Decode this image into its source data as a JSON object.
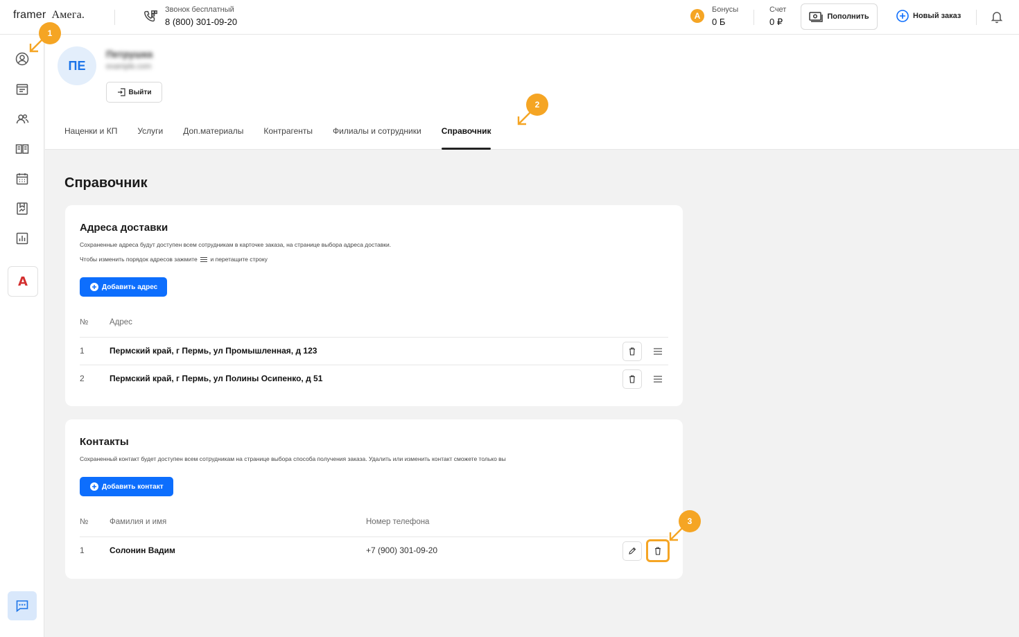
{
  "topbar": {
    "logo_primary": "framer",
    "logo_secondary": "Амега.",
    "call_label": "Звонок бесплатный",
    "call_number": "8 (800) 301-09-20",
    "bonus_icon_letter": "A",
    "bonus_label": "Бонусы",
    "bonus_value": "0 Б",
    "account_label": "Счет",
    "account_value": "0 ₽",
    "topup_label": "Пополнить",
    "new_order_label": "Новый заказ"
  },
  "sidebar": {
    "items": [
      "profile-icon",
      "orders-icon",
      "users-icon",
      "catalog-icon",
      "calendar-icon",
      "gallery-icon",
      "reports-icon"
    ],
    "brand_letter": "A"
  },
  "profile": {
    "initials": "ПЕ",
    "name": "Петрушка",
    "email": "example.com",
    "logout_label": "Выйти"
  },
  "tabs": [
    {
      "label": "Наценки и КП",
      "active": false
    },
    {
      "label": "Услуги",
      "active": false
    },
    {
      "label": "Доп.материалы",
      "active": false
    },
    {
      "label": "Контрагенты",
      "active": false
    },
    {
      "label": "Филиалы и сотрудники",
      "active": false
    },
    {
      "label": "Справочник",
      "active": true
    }
  ],
  "page_title": "Справочник",
  "addresses": {
    "title": "Адреса доставки",
    "desc1": "Сохраненные адреса будут доступен всем сотрудникам в карточке заказа, на странице выбора адреса доставки.",
    "desc2_before": "Чтобы изменить порядок адресов зажмите",
    "desc2_after": "и перетащите строку",
    "add_label": "Добавить адрес",
    "col_num": "№",
    "col_address": "Адрес",
    "rows": [
      {
        "num": "1",
        "address": "Пермский край, г Пермь, ул Промышленная, д 123"
      },
      {
        "num": "2",
        "address": "Пермский край, г Пермь, ул Полины Осипенко, д 51"
      }
    ]
  },
  "contacts": {
    "title": "Контакты",
    "desc": "Сохраненный контакт будет доступен всем сотрудникам на странице выбора способа получения заказа. Удалить или изменить контакт сможете только вы",
    "add_label": "Добавить контакт",
    "col_num": "№",
    "col_name": "Фамилия и имя",
    "col_phone": "Номер телефона",
    "rows": [
      {
        "num": "1",
        "name": "Солонин Вадим",
        "phone": "+7 (900) 301-09-20"
      }
    ]
  },
  "markers": [
    "1",
    "2",
    "3"
  ],
  "colors": {
    "accent": "#0d6efd",
    "annotation": "#f5a524",
    "background": "#f2f2f2"
  }
}
